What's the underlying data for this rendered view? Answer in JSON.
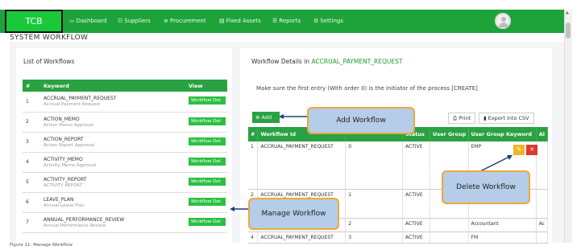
{
  "app": {
    "logo": "TCB"
  },
  "nav": [
    {
      "icon": "▭",
      "label": "Dashboard"
    },
    {
      "icon": "☷",
      "label": "Suppliers"
    },
    {
      "icon": "≡",
      "label": "Procurement"
    },
    {
      "icon": "▤",
      "label": "Fixed Assets"
    },
    {
      "icon": "☰",
      "label": "Reports"
    },
    {
      "icon": "⚙",
      "label": "Settings"
    }
  ],
  "page": {
    "title": "SYSTEM WORKFLOW"
  },
  "workflows": {
    "title": "List of Workflows",
    "headers": [
      "#",
      "Keyword",
      "View"
    ],
    "button_label": "Workflow Det",
    "rows": [
      {
        "num": "1",
        "keyword": "ACCRUAL_PAYMENT_REQUEST",
        "desc": "Accrual Payment Request"
      },
      {
        "num": "2",
        "keyword": "ACTION_MEMO",
        "desc": "Action Memo Approval"
      },
      {
        "num": "3",
        "keyword": "ACTION_REPORT",
        "desc": "Action Report Approval"
      },
      {
        "num": "4",
        "keyword": "ACTIVITY_MEMO",
        "desc": "Activity Memo Approval"
      },
      {
        "num": "5",
        "keyword": "ACTIVITY_REPORT",
        "desc": "ACTIVITY REPORT"
      },
      {
        "num": "6",
        "keyword": "LEAVE_PLAN",
        "desc": "Annual Leave Plan"
      },
      {
        "num": "7",
        "keyword": "ANNUAL_PERFORMANCE_REVIEW",
        "desc": "Annual Performance Review"
      }
    ]
  },
  "details": {
    "title_prefix": "Workflow Details in",
    "title_value": "ACCRUAL_PAYMENT_REQUEST",
    "note": "Make sure the first entry (With order 0) is the initiator of the process [CREATE]",
    "add_label": "Add",
    "print_label": "Print",
    "export_label": "Export into CSV",
    "headers": [
      "#",
      "Workflow Id",
      "",
      "Status",
      "User Group",
      "User Group Keyword",
      "Al"
    ],
    "rows": [
      {
        "num": "1",
        "workflow_id": "ACCRUAL_PAYMENT_REQUEST",
        "order": "0",
        "status": "ACTIVE",
        "group": "",
        "group_keyword": "EMP",
        "extra": ""
      },
      {
        "num": "2",
        "workflow_id": "ACCRUAL_PAYMENT_REQUEST",
        "order": "1",
        "status": "ACTIVE",
        "group": "",
        "group_keyword": "",
        "extra": ""
      },
      {
        "num": "3",
        "workflow_id": "",
        "order": "2",
        "status": "ACTIVE",
        "group": "",
        "group_keyword": "Accountant",
        "extra": "Ac"
      },
      {
        "num": "4",
        "workflow_id": "ACCRUAL_PAYMENT_REQUEST",
        "order": "3",
        "status": "ACTIVE",
        "group": "",
        "group_keyword": "FM",
        "extra": ""
      }
    ]
  },
  "callouts": {
    "add": "Add Workflow",
    "delete": "Delete Workflow",
    "manage": "Manage Workflow"
  },
  "caption": "Figure 11: Manage Workflow",
  "colors": {
    "primary": "#1ea33a",
    "accent": "#f0a73a",
    "callout_bg": "#b5cde8",
    "delete": "#e0382f",
    "edit": "#f0b428"
  }
}
